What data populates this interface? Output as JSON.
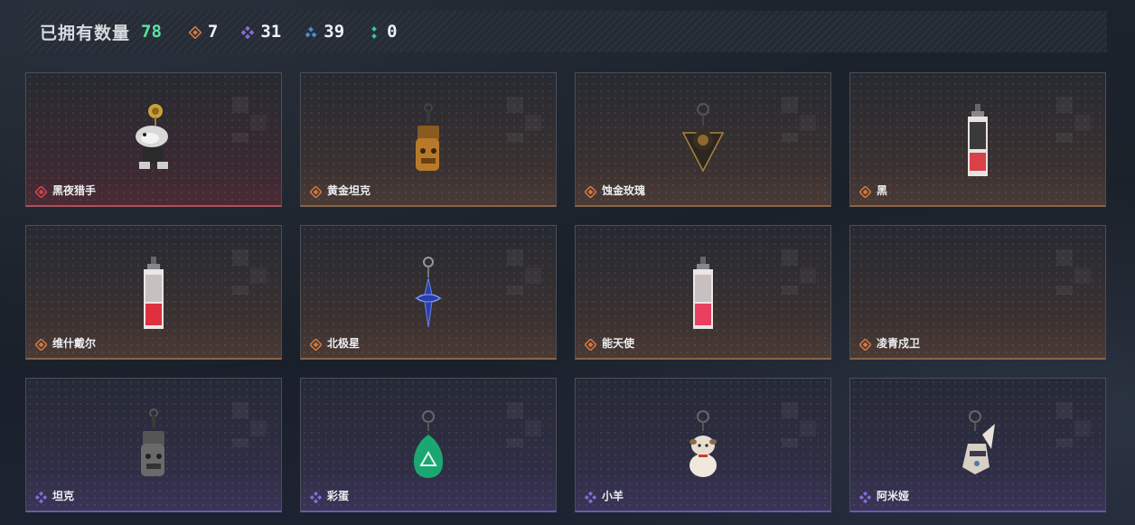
{
  "header": {
    "owned_label": "已拥有数量",
    "owned_count": "78",
    "stats": [
      {
        "icon": "orange-diamond-icon",
        "value": "7",
        "color": "#d9793e"
      },
      {
        "icon": "purple-diamond-icon",
        "value": "31",
        "color": "#8a6ad8"
      },
      {
        "icon": "blue-triangle-icon",
        "value": "39",
        "color": "#4b8fd6"
      },
      {
        "icon": "green-dots-icon",
        "value": "0",
        "color": "#3ec49a"
      }
    ]
  },
  "colors": {
    "red": "#d6454f",
    "orange": "#d9793e",
    "purple": "#8a6ad8",
    "accent_green": "#5de3a2"
  },
  "cards": [
    {
      "name": "黑夜猎手",
      "rarity": "red",
      "item": "cat-hunter"
    },
    {
      "name": "黄金坦克",
      "rarity": "orange",
      "item": "golden-tank"
    },
    {
      "name": "蚀金玫瑰",
      "rarity": "orange",
      "item": "gold-rose"
    },
    {
      "name": "黑",
      "rarity": "orange",
      "item": "card-black"
    },
    {
      "name": "维什戴尔",
      "rarity": "orange",
      "item": "card-red"
    },
    {
      "name": "北极星",
      "rarity": "orange",
      "item": "polaris"
    },
    {
      "name": "能天使",
      "rarity": "orange",
      "item": "card-red"
    },
    {
      "name": "凌青戍卫",
      "rarity": "orange",
      "item": "empty"
    },
    {
      "name": "坦克",
      "rarity": "purple",
      "item": "tank"
    },
    {
      "name": "彩蛋",
      "rarity": "purple",
      "item": "egg"
    },
    {
      "name": "小羊",
      "rarity": "purple",
      "item": "sheep"
    },
    {
      "name": "阿米娅",
      "rarity": "purple",
      "item": "amiya"
    }
  ]
}
